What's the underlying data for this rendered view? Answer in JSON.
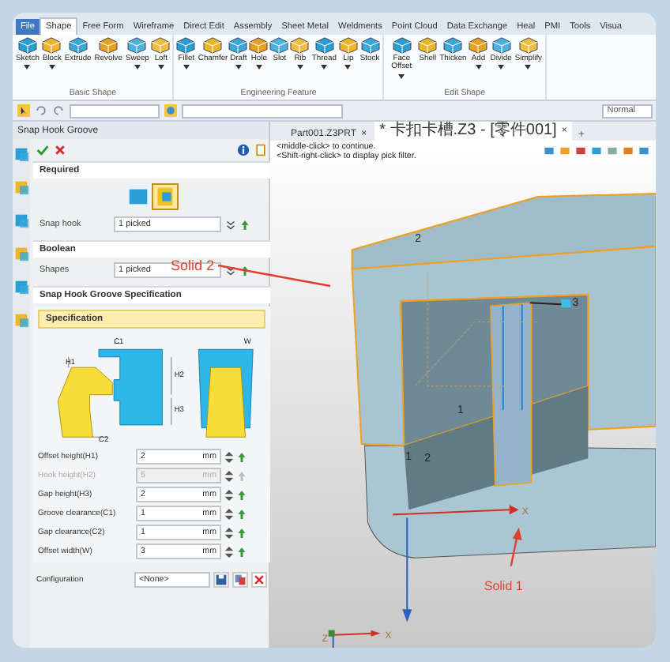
{
  "menu_tabs": [
    {
      "label": "File",
      "kind": "file",
      "selected": false
    },
    {
      "label": "Shape",
      "kind": "tab",
      "selected": true
    },
    {
      "label": "Free Form",
      "kind": "tab",
      "selected": false
    },
    {
      "label": "Wireframe",
      "kind": "tab",
      "selected": false
    },
    {
      "label": "Direct Edit",
      "kind": "tab",
      "selected": false
    },
    {
      "label": "Assembly",
      "kind": "tab",
      "selected": false
    },
    {
      "label": "Sheet Metal",
      "kind": "tab",
      "selected": false
    },
    {
      "label": "Weldments",
      "kind": "tab",
      "selected": false
    },
    {
      "label": "Point Cloud",
      "kind": "tab",
      "selected": false
    },
    {
      "label": "Data Exchange",
      "kind": "tab",
      "selected": false
    },
    {
      "label": "Heal",
      "kind": "tab",
      "selected": false
    },
    {
      "label": "PMI",
      "kind": "tab",
      "selected": false
    },
    {
      "label": "Tools",
      "kind": "tab",
      "selected": false
    },
    {
      "label": "Visua",
      "kind": "tab",
      "selected": false
    }
  ],
  "ribbon_groups": [
    {
      "label": "Basic Shape",
      "tools": [
        {
          "label": "Sketch",
          "dropdown": true
        },
        {
          "label": "Block",
          "dropdown": true
        },
        {
          "label": "Extrude",
          "dropdown": false
        },
        {
          "label": "Revolve",
          "dropdown": false
        },
        {
          "label": "Sweep",
          "dropdown": true
        },
        {
          "label": "Loft",
          "dropdown": true
        }
      ]
    },
    {
      "label": "Engineering Feature",
      "tools": [
        {
          "label": "Fillet",
          "dropdown": true
        },
        {
          "label": "Chamfer",
          "dropdown": false
        },
        {
          "label": "Draft",
          "dropdown": true
        },
        {
          "label": "Hole",
          "dropdown": true
        },
        {
          "label": "Slot",
          "dropdown": false
        },
        {
          "label": "Rib",
          "dropdown": true
        },
        {
          "label": "Thread",
          "dropdown": true
        },
        {
          "label": "Lip",
          "dropdown": true
        },
        {
          "label": "Stock",
          "dropdown": false
        }
      ]
    },
    {
      "label": "Edit Shape",
      "tools": [
        {
          "label": "Face Offset",
          "dropdown": true
        },
        {
          "label": "Shell",
          "dropdown": false
        },
        {
          "label": "Thicken",
          "dropdown": false
        },
        {
          "label": "Add",
          "dropdown": true
        },
        {
          "label": "Divide",
          "dropdown": true
        },
        {
          "label": "Simplify",
          "dropdown": true
        }
      ]
    }
  ],
  "toolbar": {
    "view_mode": "Normal"
  },
  "panel": {
    "title": "Snap Hook Groove",
    "required": {
      "title": "Required",
      "field_label": "Snap hook",
      "field_value": "1 picked"
    },
    "boolean": {
      "title": "Boolean",
      "field_label": "Shapes",
      "field_value": "1 picked"
    },
    "spec_section": "Snap Hook Groove Specification",
    "spec_subsection": "Specification",
    "diagram_labels": [
      "C1",
      "H1",
      "H2",
      "H3",
      "C2",
      "W"
    ],
    "parameters": [
      {
        "label": "Offset height(H1)",
        "value": "2",
        "unit": "mm",
        "disabled": false
      },
      {
        "label": "Hook height(H2)",
        "value": "5",
        "unit": "mm",
        "disabled": true
      },
      {
        "label": "Gap height(H3)",
        "value": "2",
        "unit": "mm",
        "disabled": false
      },
      {
        "label": "Groove clearance(C1)",
        "value": "1",
        "unit": "mm",
        "disabled": false
      },
      {
        "label": "Gap clearance(C2)",
        "value": "1",
        "unit": "mm",
        "disabled": false
      },
      {
        "label": "Offset width(W)",
        "value": "3",
        "unit": "mm",
        "disabled": false
      }
    ],
    "configuration": {
      "label": "Configuration",
      "value": "<None>"
    }
  },
  "document_tabs": [
    {
      "label": "Part001.Z3PRT",
      "close": "×",
      "selected": false
    },
    {
      "label": "* 卡扣卡槽.Z3 - [零件001]",
      "close": "×",
      "selected": true
    }
  ],
  "new_tab": "+",
  "hints": [
    "<middle-click> to continue.",
    "<Shift-right-click> to display pick filter."
  ],
  "viewport_labels": [
    "2",
    "3",
    "1",
    "1",
    "2"
  ],
  "axis_labels": [
    "X",
    "Z",
    "X"
  ],
  "annotations": [
    "Solid 2",
    "Solid 1"
  ]
}
